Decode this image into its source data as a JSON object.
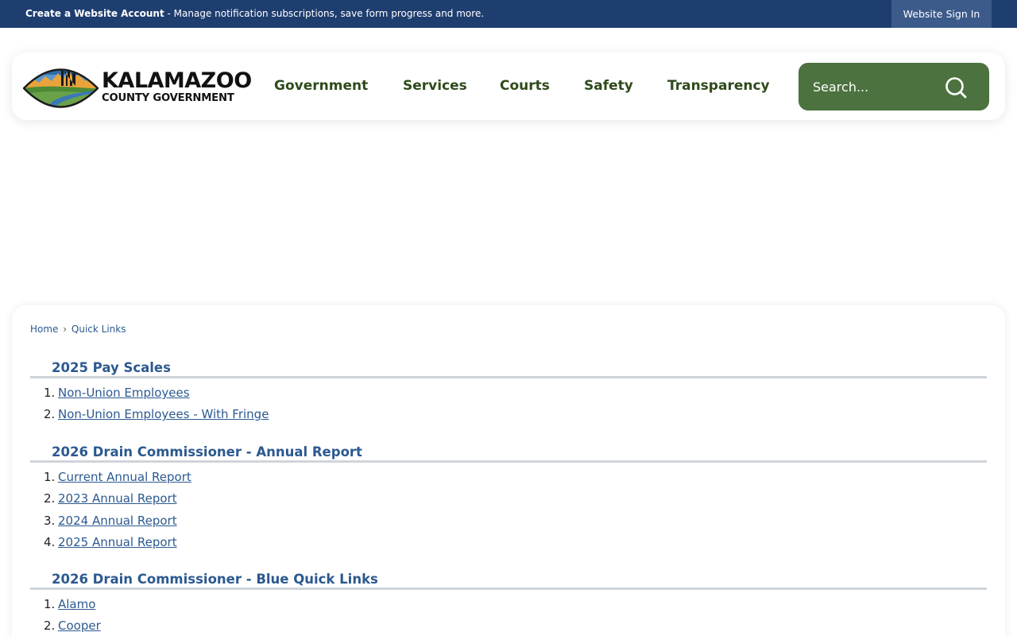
{
  "topbar": {
    "account_link": "Create a Website Account",
    "account_desc": " - Manage notification subscriptions, save form progress and more.",
    "signin_label": "Website Sign In"
  },
  "header": {
    "logo_line1": "KALAMAZOO",
    "logo_line2": "COUNTY GOVERNMENT",
    "nav": [
      "Government",
      "Services",
      "Courts",
      "Safety",
      "Transparency"
    ],
    "search_placeholder": "Search..."
  },
  "breadcrumb": {
    "home": "Home",
    "separator": "›",
    "current": "Quick Links"
  },
  "sections": [
    {
      "title": "2025 Pay Scales",
      "items": [
        {
          "num": "1.",
          "label": "Non-Union Employees"
        },
        {
          "num": "2.",
          "label": "Non-Union Employees - With Fringe"
        }
      ]
    },
    {
      "title": "2026 Drain Commissioner - Annual Report",
      "items": [
        {
          "num": "1.",
          "label": "Current Annual Report"
        },
        {
          "num": "2.",
          "label": "2023 Annual Report"
        },
        {
          "num": "3.",
          "label": "2024 Annual Report"
        },
        {
          "num": "4.",
          "label": "2025 Annual Report"
        }
      ]
    },
    {
      "title": "2026 Drain Commissioner - Blue Quick Links",
      "items": [
        {
          "num": "1.",
          "label": "Alamo"
        },
        {
          "num": "2.",
          "label": "Cooper"
        }
      ]
    }
  ],
  "colors": {
    "topbar_bg": "#1f3e70",
    "signin_bg": "#3c5a8a",
    "nav_text": "#2f4a1a",
    "search_bg": "#4c7240",
    "link": "#2c5990",
    "section_rule": "#cfd4da"
  },
  "icons": {
    "search": "magnifier-icon",
    "logo": "county-landscape-logo"
  }
}
